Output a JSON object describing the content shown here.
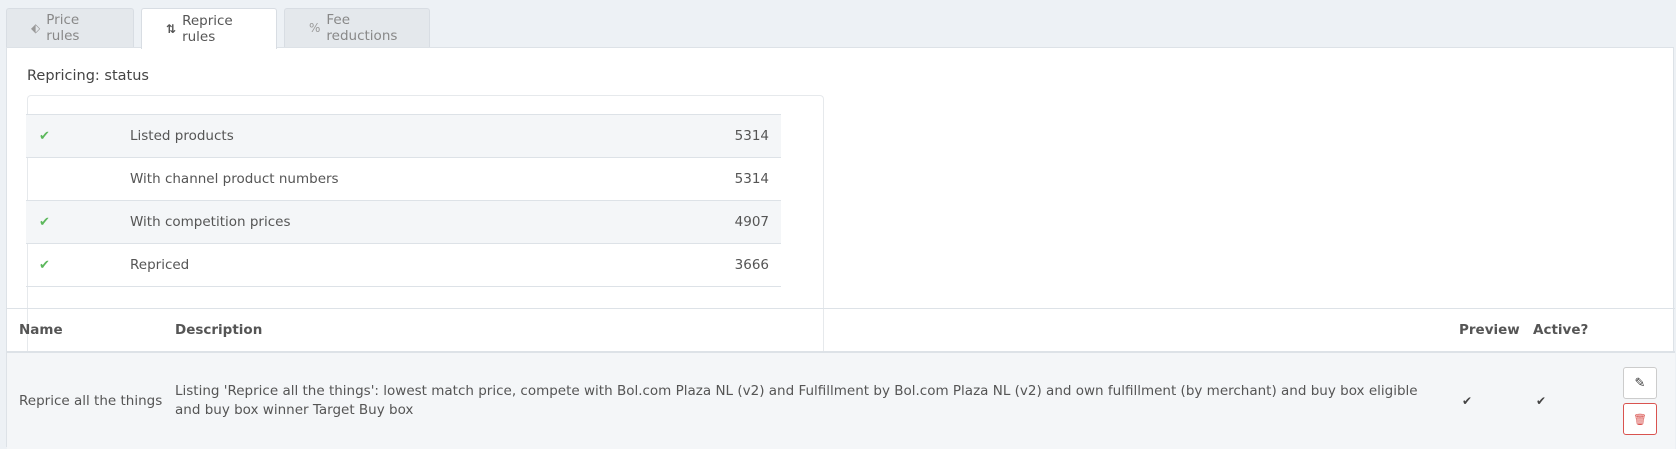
{
  "tabs": [
    {
      "icon": "tag-icon",
      "glyph": "⬖",
      "label": "Price rules"
    },
    {
      "icon": "sort-icon",
      "glyph": "⇅",
      "label": "Reprice rules"
    },
    {
      "icon": "percent-icon",
      "glyph": "%",
      "label": "Fee reductions"
    }
  ],
  "status": {
    "title": "Repricing: status",
    "rows": [
      {
        "checked": true,
        "check_glyph": "✔",
        "label": "Listed products",
        "value": "5314"
      },
      {
        "checked": false,
        "check_glyph": "",
        "label": "With channel product numbers",
        "value": "5314"
      },
      {
        "checked": true,
        "check_glyph": "✔",
        "label": "With competition prices",
        "value": "4907"
      },
      {
        "checked": true,
        "check_glyph": "✔",
        "label": "Repriced",
        "value": "3666"
      }
    ]
  },
  "rules": {
    "headers": {
      "name": "Name",
      "description": "Description",
      "preview": "Preview",
      "active": "Active?"
    },
    "rows": [
      {
        "name": "Reprice all the things",
        "description": "Listing 'Reprice all the things': lowest match price, compete with Bol.com Plaza NL (v2) and Fulfillment by Bol.com Plaza NL (v2) and own fulfillment (by merchant) and buy box eligible and buy box winner Target Buy box",
        "preview_glyph": "✔",
        "active_glyph": "✔",
        "edit_glyph": "✎",
        "delete_glyph": "🗑"
      }
    ]
  },
  "colors": {
    "check": "#5cb85c",
    "danger": "#d9534f",
    "background": "#edf1f5"
  }
}
